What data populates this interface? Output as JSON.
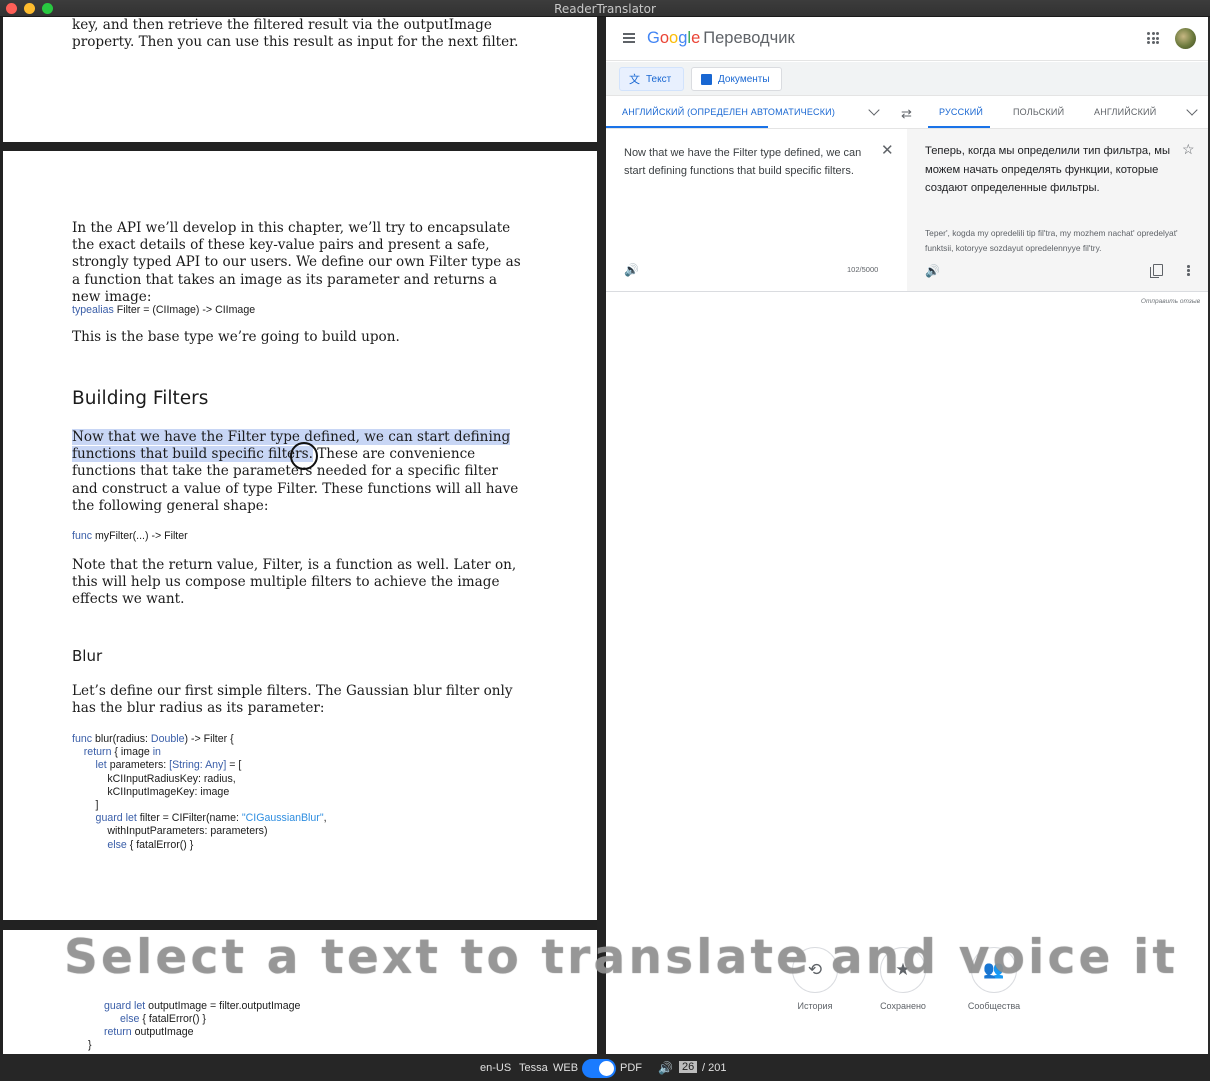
{
  "window": {
    "title": "ReaderTranslator"
  },
  "reader": {
    "page1_lines": [
      "key, and then retrieve the filtered result via the outputImage",
      "property. Then you can use this result as input for the next filter."
    ],
    "para1": "In the API we’ll develop in this chapter, we’ll try to encapsulate the exact details of these key-value pairs and present a safe, strongly typed API to our users. We define our own Filter type as a function that takes an image as its parameter and returns a new image:",
    "code_typealias_kw": "typealias",
    "code_typealias_rest": " Filter = (CIImage) -> CIImage",
    "para2": "This is the base type we’re going to build upon.",
    "heading_building": "Building Filters",
    "para3_highlight": "Now that we have the Filter type defined, we can start defining functions that build specific filters.",
    "para3_rest": " These are convenience functions that take the parameters needed for a specific filter and construct a value of type Filter. These functions will all have the following general shape:",
    "code_func_kw": "func",
    "code_func_rest": " myFilter(...) -> Filter",
    "para4": "Note that the return value, Filter, is a function as well. Later on, this will help us compose multiple filters to achieve the image effects we want.",
    "heading_blur": "Blur",
    "para5": "Let’s define our first simple filters. The Gaussian blur filter only has the blur radius as its parameter:",
    "page3_code": [
      "guard let outputImage = filter.outputImage",
      "else { fatalError() }",
      "return outputImage",
      "}"
    ]
  },
  "translator": {
    "logo_letters": [
      "G",
      "o",
      "o",
      "g",
      "l",
      "e"
    ],
    "product": "Переводчик",
    "mode_text": "Текст",
    "mode_docs": "Документы",
    "source_lang": "АНГЛИЙСКИЙ (ОПРЕДЕЛЕН АВТОМАТИЧЕСКИ)",
    "target_langs": [
      "РУССКИЙ",
      "ПОЛЬСКИЙ",
      "АНГЛИЙСКИЙ"
    ],
    "source_text": "Now that we have the Filter type defined, we can start defining functions that build specific filters.",
    "char_count": "102/5000",
    "translation": "Теперь, когда мы определили тип фильтра, мы можем начать определять функции, которые создают определенные фильтры.",
    "transliteration": "Teper', kogda my opredelili tip fil'tra, my mozhem nachat' opredelyat' funktsii, kotoryye sozdayut opredelennyye fil'try.",
    "feedback": "Отправить отзыв",
    "actions": [
      "История",
      "Сохранено",
      "Сообщества"
    ]
  },
  "overlay": {
    "caption": "Select a text to translate and voice it"
  },
  "statusbar": {
    "locale": "en-US",
    "voice": "Tessa",
    "web": "WEB",
    "pdf": "PDF",
    "page_current": "26",
    "page_total": "/ 201"
  },
  "colors": {
    "accent": "#1a73e8",
    "highlight": "#c8d6f5",
    "toggle": "#1a7bff"
  }
}
